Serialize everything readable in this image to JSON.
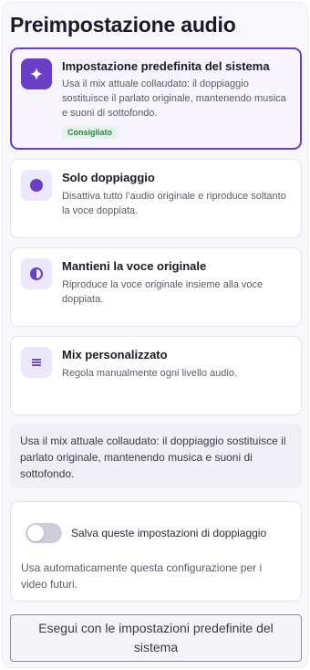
{
  "page": {
    "title": "Preimpostazione audio"
  },
  "options": [
    {
      "title": "Impostazione predefinita del sistema",
      "description": "Usa il mix attuale collaudato: il doppiaggio sostituisce il parlato originale, mantenendo musica e suoni di sottofondo.",
      "badge": "Consigliato",
      "icon": "sparkle-icon",
      "selected": true
    },
    {
      "title": "Solo doppiaggio",
      "description": "Disattiva tutto l’audio originale e riproduce soltanto la voce doppiata.",
      "icon": "dot-icon",
      "selected": false
    },
    {
      "title": "Mantieni la voce originale",
      "description": "Riproduce la voce originale insieme alla voce doppiata.",
      "icon": "half-circle-icon",
      "selected": false
    },
    {
      "title": "Mix personalizzato",
      "description": "Regola manualmente ogni livello audio.",
      "icon": "list-icon",
      "selected": false
    }
  ],
  "summary": {
    "text": "Usa il mix attuale collaudato: il doppiaggio sostituisce il parlato originale, mantenendo musica e suoni di sottofondo."
  },
  "save_settings": {
    "toggle_label": "Salva queste impostazioni di doppiaggio",
    "toggle_on": false,
    "description": "Usa automaticamente questa configurazione per i video futuri."
  },
  "run_button": {
    "label": "Esegui con le impostazioni predefinite del sistema"
  },
  "colors": {
    "accent": "#6a3fc6",
    "accent_light": "#ece7fb",
    "badge_bg": "#e3f5e8",
    "badge_text": "#1f8a44"
  }
}
